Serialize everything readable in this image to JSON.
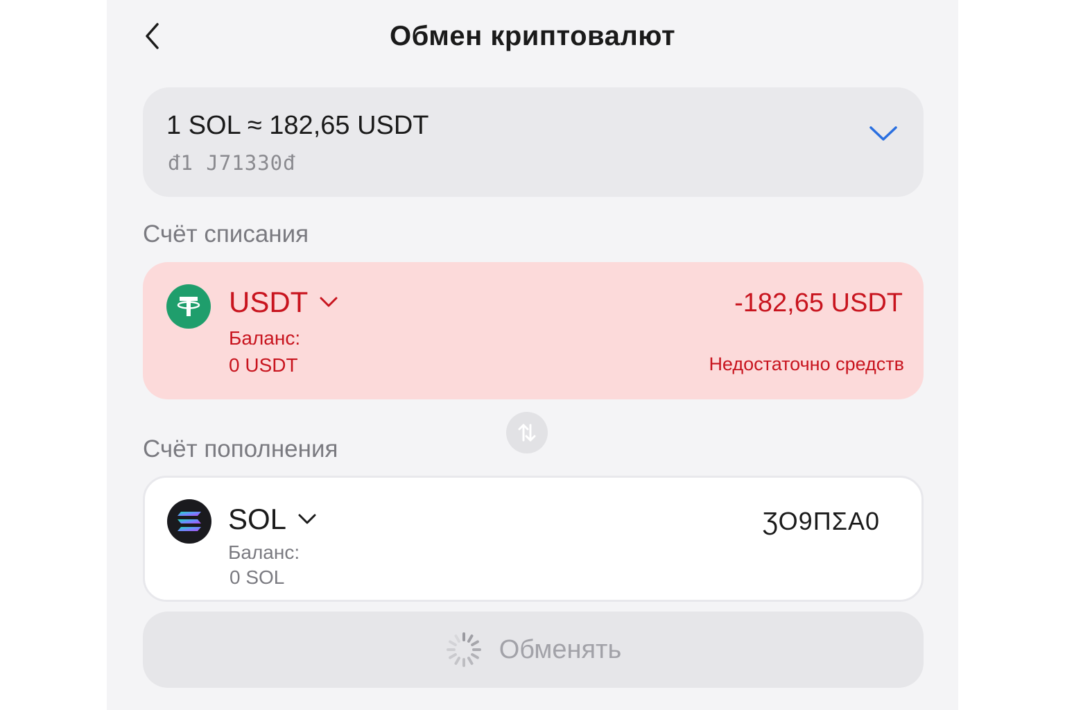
{
  "header": {
    "title": "Обмен криптовалют",
    "back_icon": "chevron-left-icon"
  },
  "rate": {
    "text": "1 SOL ≈ 182,65 USDT",
    "sub": "đ1 J71330đ",
    "chevron_icon": "chevron-down-icon",
    "chevron_color": "#2a6fe0"
  },
  "debit": {
    "section_label": "Счёт списания",
    "coin": "USDT",
    "coin_icon": "tether-icon",
    "balance_label": "Баланс:",
    "balance_value": "0 USDT",
    "amount": "-182,65 USDT",
    "warning": "Недостаточно средств",
    "accent_color": "#c8141e",
    "background_color": "#fcdada"
  },
  "swap": {
    "icon": "swap-arrows-icon"
  },
  "credit": {
    "section_label": "Счёт пополнения",
    "coin": "SOL",
    "coin_icon": "solana-icon",
    "balance_label": "Баланс:",
    "balance_value": "0 SOL",
    "amount": "ƷO9ΠΣA0"
  },
  "action": {
    "label": "Обменять",
    "spinner_icon": "loading-spinner-icon",
    "state": "disabled-loading"
  }
}
